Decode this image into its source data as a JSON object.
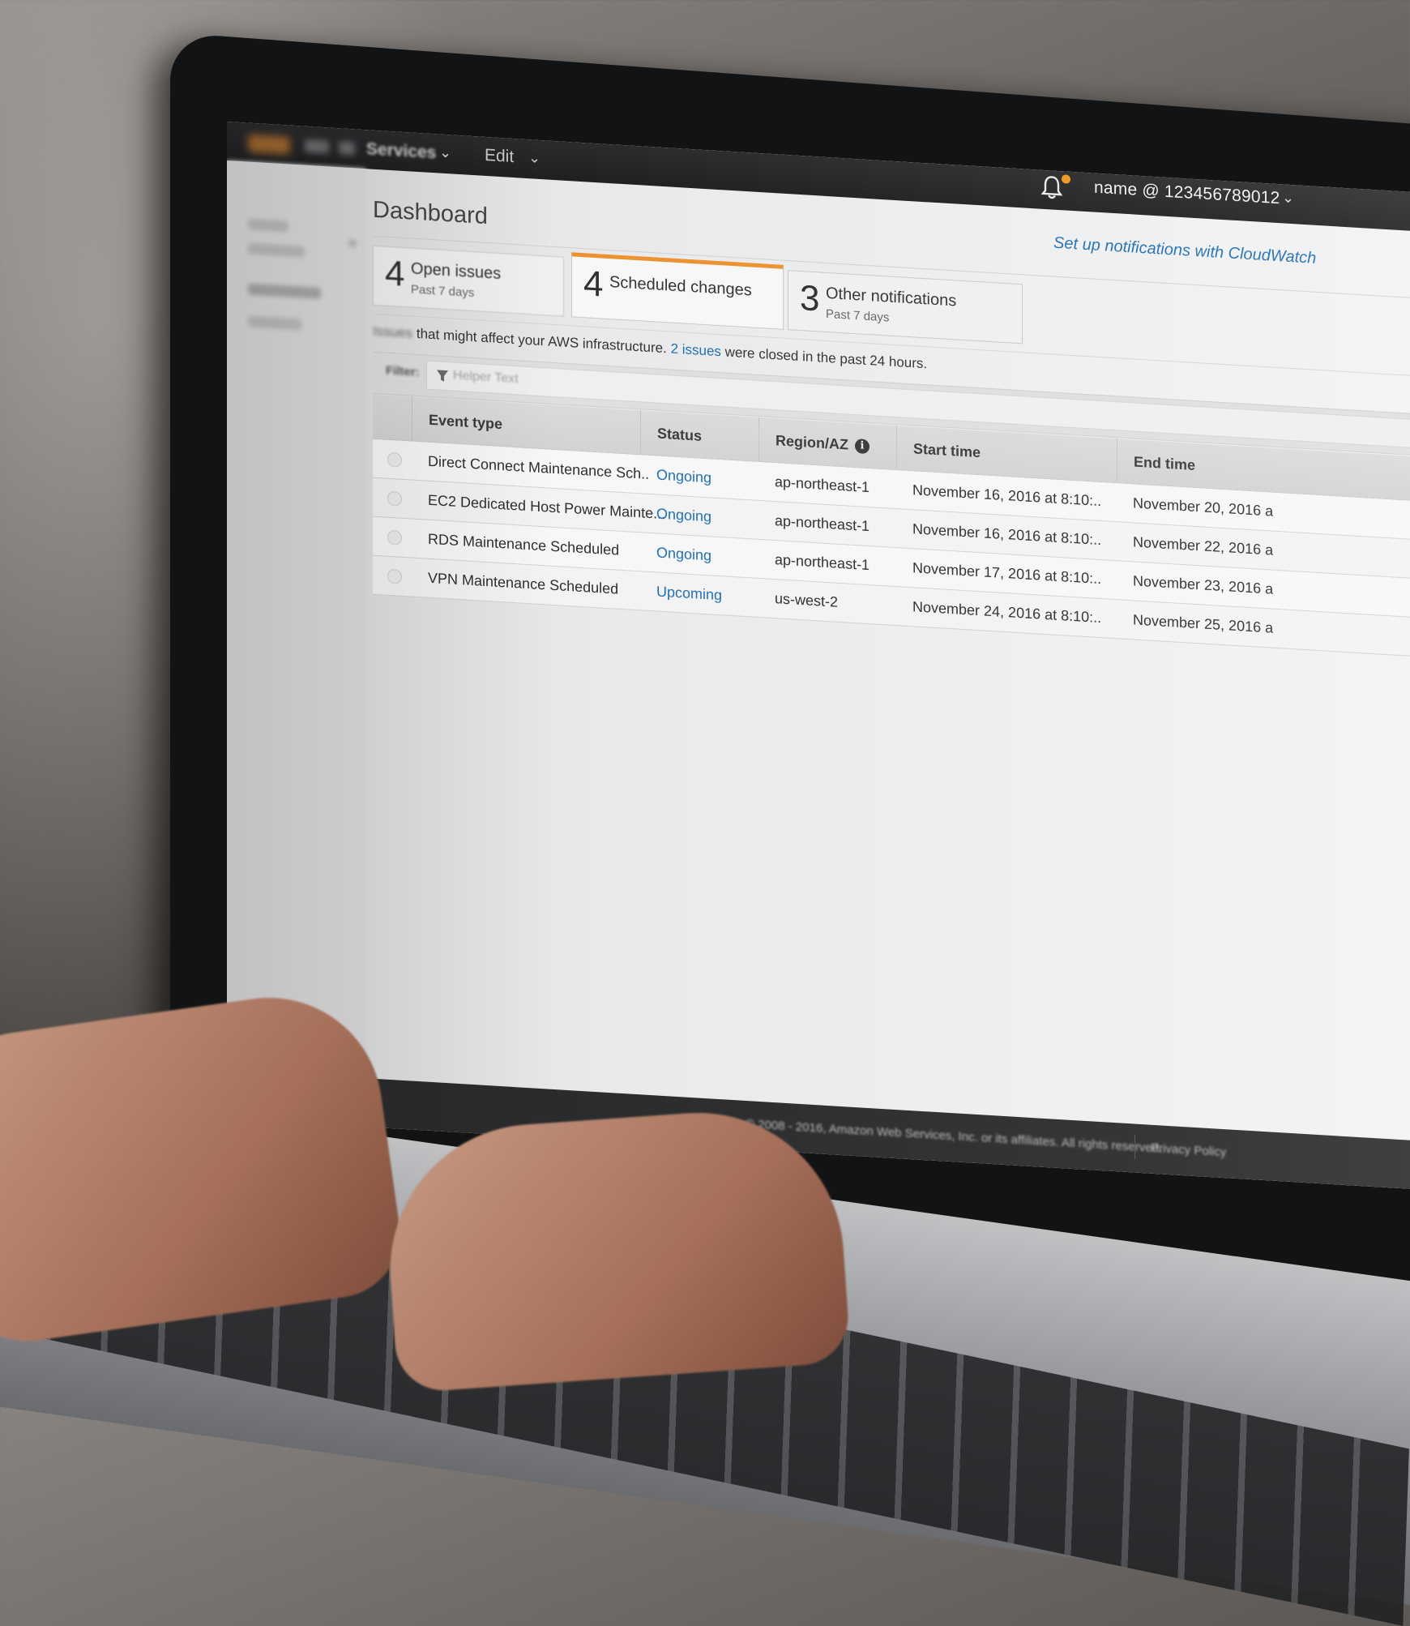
{
  "topnav": {
    "services_label": "Services",
    "edit_label": "Edit",
    "notification_indicator_color": "#f0941f",
    "account_label": "name @ 123456789012"
  },
  "page": {
    "title": "Dashboard",
    "cloudwatch_link": "Set up notifications with CloudWatch"
  },
  "summary_cards": [
    {
      "count": "4",
      "label": "Open issues",
      "sublabel": "Past 7 days",
      "active": false
    },
    {
      "count": "4",
      "label": "Scheduled changes",
      "sublabel": "",
      "active": true
    },
    {
      "count": "3",
      "label": "Other notifications",
      "sublabel": "Past 7 days",
      "active": false
    }
  ],
  "info": {
    "prefix": "Issues",
    "text_before_link": " that might affect your AWS infrastructure. ",
    "link_text": "2 issues",
    "text_after_link": " were closed in the past 24 hours."
  },
  "filter": {
    "label": "Filter:",
    "placeholder": "Helper Text",
    "value": ""
  },
  "table": {
    "columns": [
      "Event type",
      "Status",
      "Region/AZ",
      "Start time",
      "End time"
    ],
    "rows": [
      {
        "event_type": "Direct Connect Maintenance Sch..",
        "status": "Ongoing",
        "region": "ap-northeast-1",
        "start_time": "November 16, 2016 at 8:10:..",
        "end_time": "November 20, 2016 a"
      },
      {
        "event_type": "EC2 Dedicated Host Power Mainte...",
        "status": "Ongoing",
        "region": "ap-northeast-1",
        "start_time": "November 16, 2016 at 8:10:..",
        "end_time": "November 22, 2016 a"
      },
      {
        "event_type": "RDS Maintenance Scheduled",
        "status": "Ongoing",
        "region": "ap-northeast-1",
        "start_time": "November 17, 2016 at 8:10:..",
        "end_time": "November 23, 2016 a"
      },
      {
        "event_type": "VPN Maintenance Scheduled",
        "status": "Upcoming",
        "region": "us-west-2",
        "start_time": "November 24, 2016 at 8:10:..",
        "end_time": "November 25, 2016 a"
      }
    ]
  },
  "footer": {
    "copyright": "© 2008 - 2016, Amazon Web Services, Inc. or its affiliates. All rights reserved.",
    "privacy_link": "Privacy Policy"
  },
  "colors": {
    "accent_orange": "#ec9130",
    "link_blue": "#1f6fb2",
    "nav_dark": "#232f3e"
  }
}
